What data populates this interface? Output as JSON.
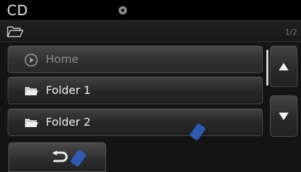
{
  "header": {
    "title": "CD",
    "icon": "disc-icon"
  },
  "path_bar": {
    "icon": "folder-open-icon",
    "page": "1/2"
  },
  "list": {
    "items": [
      {
        "label": "Home",
        "icon": "play-circle-icon"
      },
      {
        "label": "Folder 1",
        "icon": "folder-icon"
      },
      {
        "label": "Folder 2",
        "icon": "folder-icon"
      }
    ]
  },
  "controls": {
    "up_icon": "triangle-up-icon",
    "down_icon": "triangle-down-icon",
    "back_icon": "back-arrow-icon"
  },
  "colors": {
    "background": "#141414",
    "text": "#f0f0f0",
    "dim_text": "#8e8e8e",
    "glare_blue": "#2f63c9"
  }
}
